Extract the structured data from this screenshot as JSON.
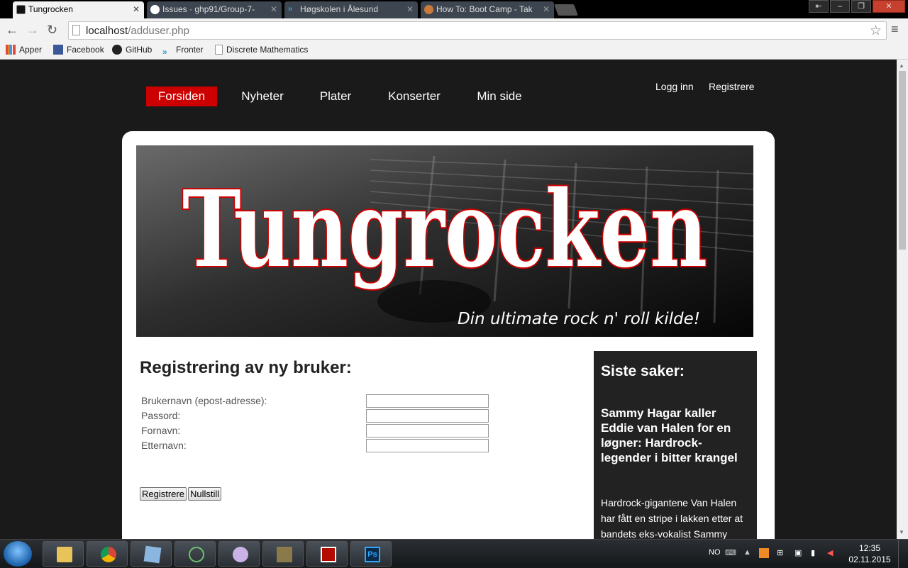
{
  "browser": {
    "tabs": [
      {
        "title": "Tungrocken",
        "active": true
      },
      {
        "title": "Issues · ghp91/Group-7-",
        "active": false
      },
      {
        "title": "Høgskolen i Ålesund",
        "active": false
      },
      {
        "title": "How To: Boot Camp - Tak",
        "active": false
      }
    ],
    "url_host": "localhost",
    "url_path": "/adduser.php",
    "bookmarks": [
      {
        "label": "Apper"
      },
      {
        "label": "Facebook"
      },
      {
        "label": "GitHub"
      },
      {
        "label": "Fronter"
      },
      {
        "label": "Discrete Mathematics"
      }
    ],
    "window_buttons": [
      "⇤",
      "–",
      "❐",
      "✕"
    ]
  },
  "site": {
    "nav": [
      {
        "label": "Forsiden",
        "active": true
      },
      {
        "label": "Nyheter"
      },
      {
        "label": "Plater"
      },
      {
        "label": "Konserter"
      },
      {
        "label": "Min side"
      }
    ],
    "login": "Logg inn",
    "register": "Registrere",
    "banner": {
      "logo_text": "Tungrocken",
      "tagline": "Din ultimate rock n' roll kilde!"
    },
    "form": {
      "title": "Registrering av ny bruker:",
      "fields": [
        {
          "label": "Brukernavn (epost-adresse):",
          "value": ""
        },
        {
          "label": "Passord:",
          "value": ""
        },
        {
          "label": "Fornavn:",
          "value": ""
        },
        {
          "label": "Etternavn:",
          "value": ""
        }
      ],
      "submit_label": "Registrere",
      "reset_label": "Nullstill"
    },
    "sidebar": {
      "title": "Siste saker:",
      "headline": "Sammy Hagar kaller Eddie van Halen for en løgner: Hardrock-legender i bitter krangel",
      "text": "Hardrock-gigantene Van Halen har fått en stripe i lakken etter at bandets eks-vokalist Sammy"
    }
  },
  "taskbar": {
    "language": "NO",
    "time": "12:35",
    "date": "02.11.2015"
  },
  "colors": {
    "accent": "#cc0000",
    "page_bg": "#1a1a1a",
    "sidebar_bg": "#222222"
  }
}
